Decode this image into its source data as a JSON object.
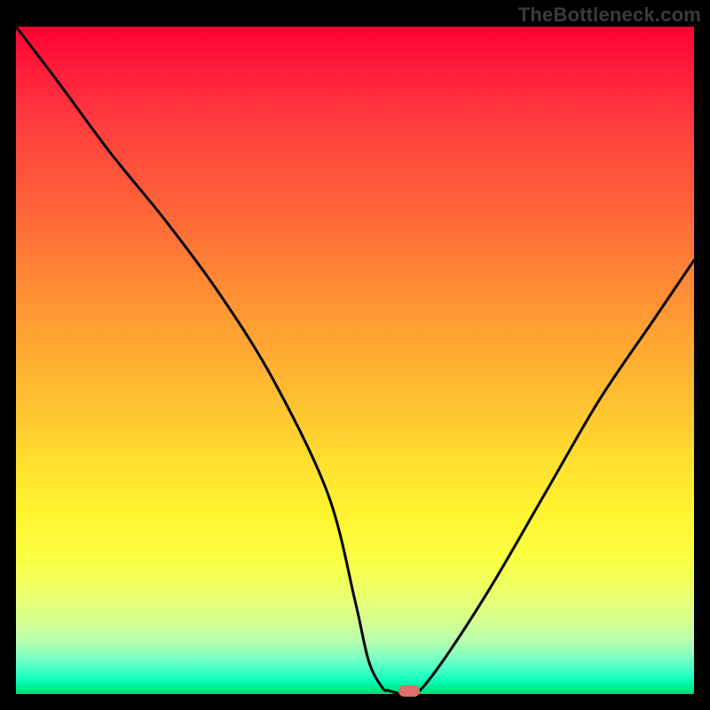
{
  "watermark": "TheBottleneck.com",
  "chart_data": {
    "type": "line",
    "title": "",
    "xlabel": "",
    "ylabel": "",
    "xlim": [
      0,
      100
    ],
    "ylim": [
      0,
      100
    ],
    "grid": false,
    "series": [
      {
        "name": "bottleneck-curve",
        "x": [
          0,
          6,
          14,
          22,
          30,
          38,
          46,
          50,
          52,
          54,
          55,
          57,
          59,
          63,
          70,
          78,
          86,
          94,
          100
        ],
        "values": [
          100,
          92,
          81,
          71,
          60,
          47,
          30,
          14,
          5,
          1,
          0.5,
          0,
          0,
          5,
          16,
          30,
          44,
          56,
          65
        ]
      }
    ],
    "marker": {
      "x": 58,
      "y": 0.5
    },
    "colors": {
      "curve": "#000000",
      "marker": "#de6d6d",
      "gradient_top": "#ff0033",
      "gradient_mid": "#ffe22f",
      "gradient_bottom": "#00db70"
    }
  }
}
